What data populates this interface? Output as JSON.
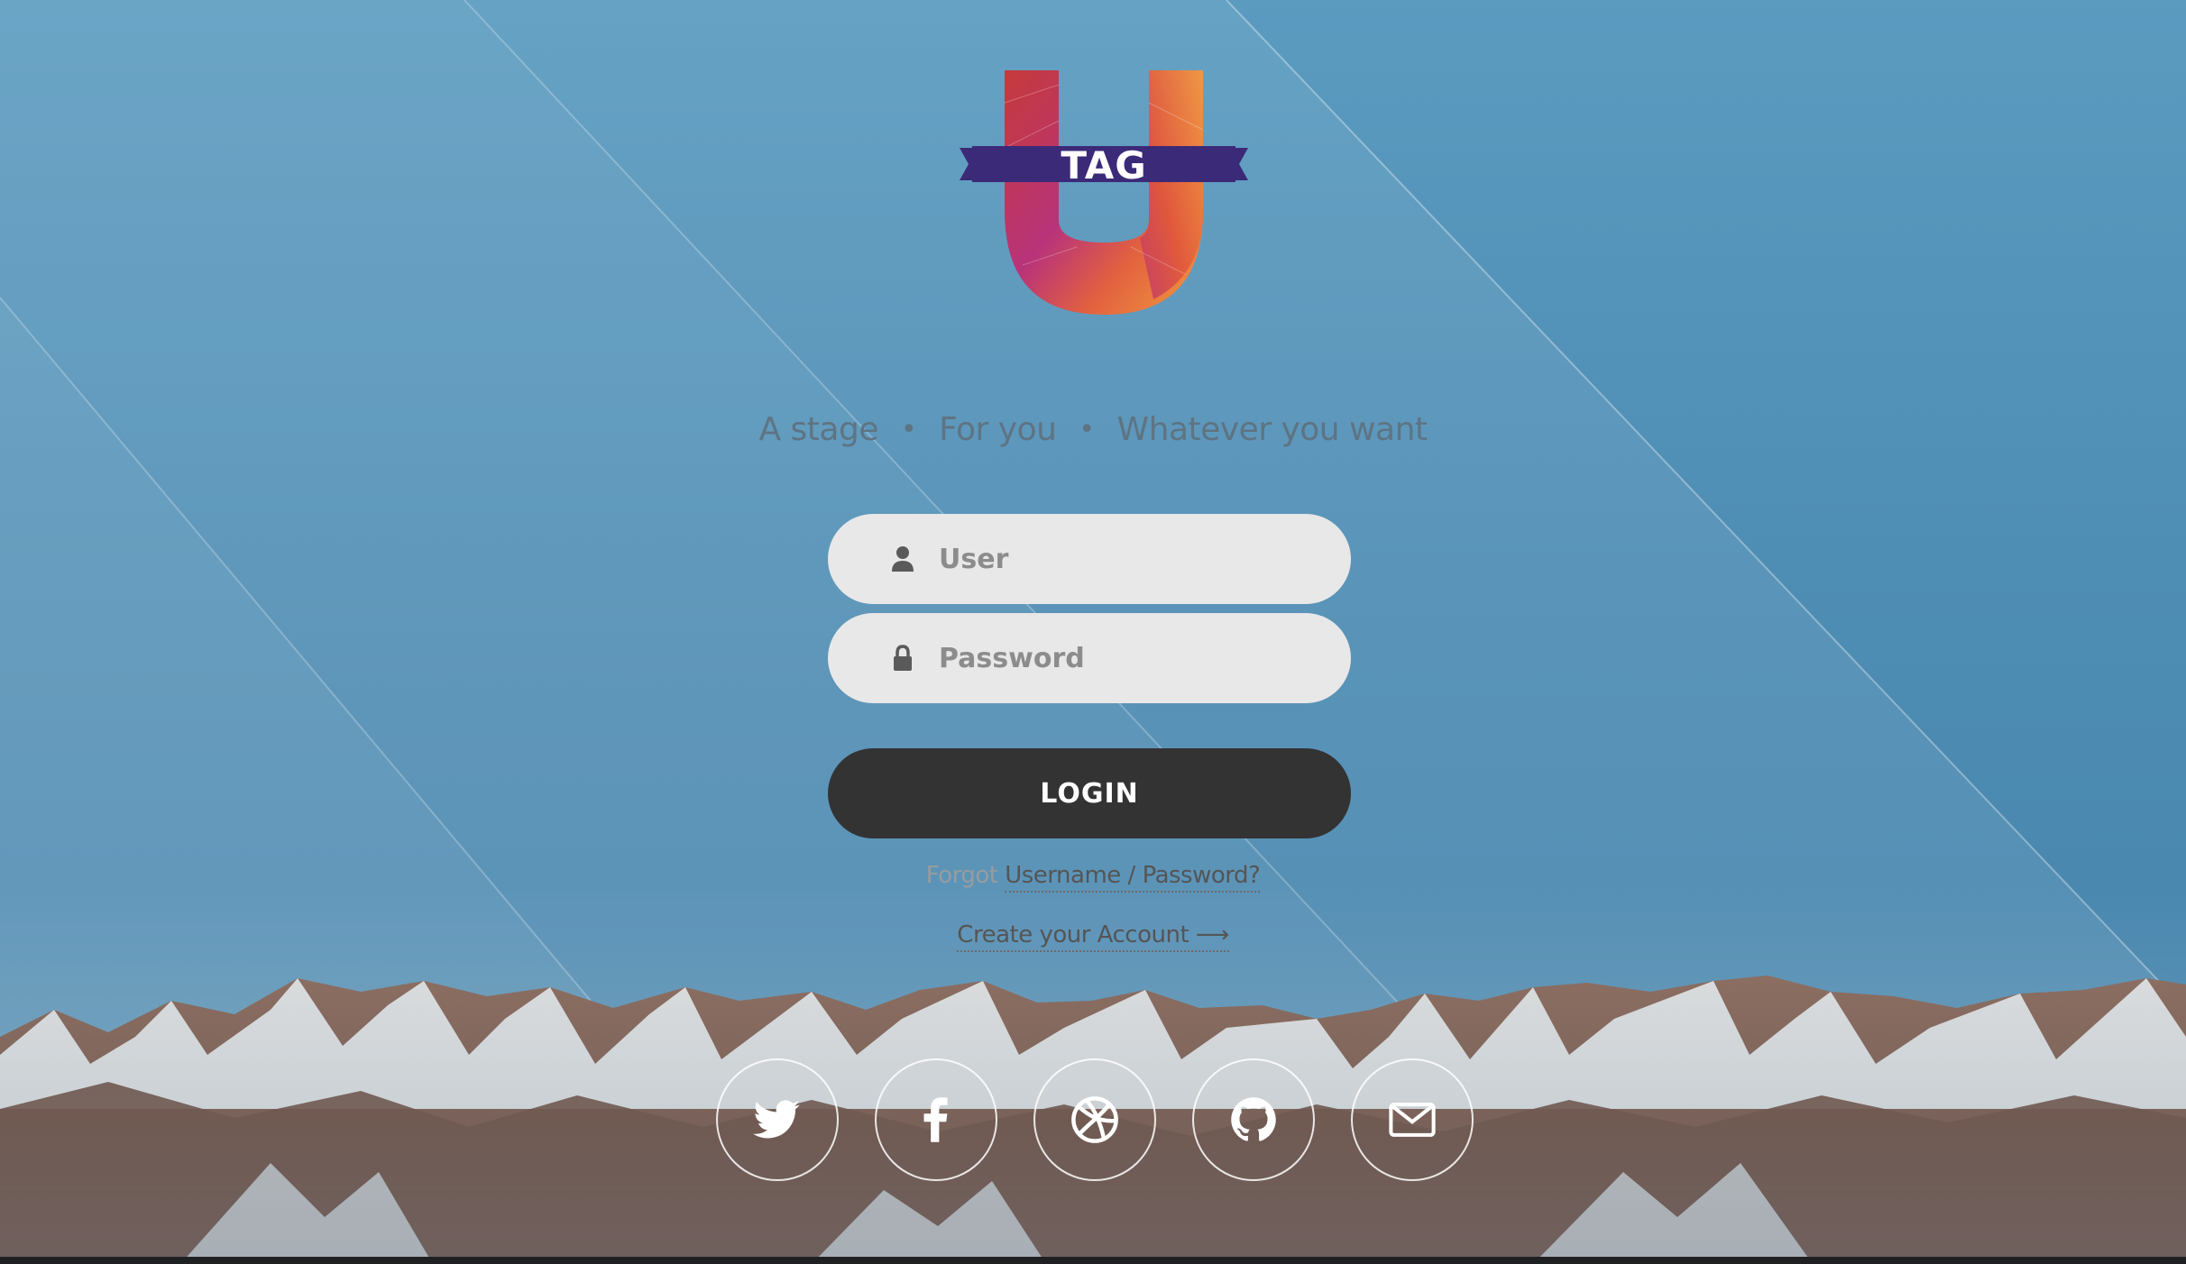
{
  "logo": {
    "text": "TAG"
  },
  "tagline": {
    "parts": [
      "A stage",
      "For you",
      "Whatever you want"
    ],
    "separator": "•"
  },
  "login_form": {
    "user_placeholder": "User",
    "password_placeholder": "Password",
    "login_label": "LOGIN",
    "forgot_prefix": "Forgot",
    "forgot_link": "Username / Password?",
    "create_account": "Create your Account ⟶"
  },
  "social": [
    {
      "icon": "twitter-icon"
    },
    {
      "icon": "facebook-icon"
    },
    {
      "icon": "dribbble-icon"
    },
    {
      "icon": "github-icon"
    },
    {
      "icon": "mail-icon"
    }
  ],
  "colors": {
    "sky": "#4f8fb6",
    "field_bg": "#e8e8e8",
    "button_bg": "#333333",
    "banner_purple": "#3b2a78"
  }
}
